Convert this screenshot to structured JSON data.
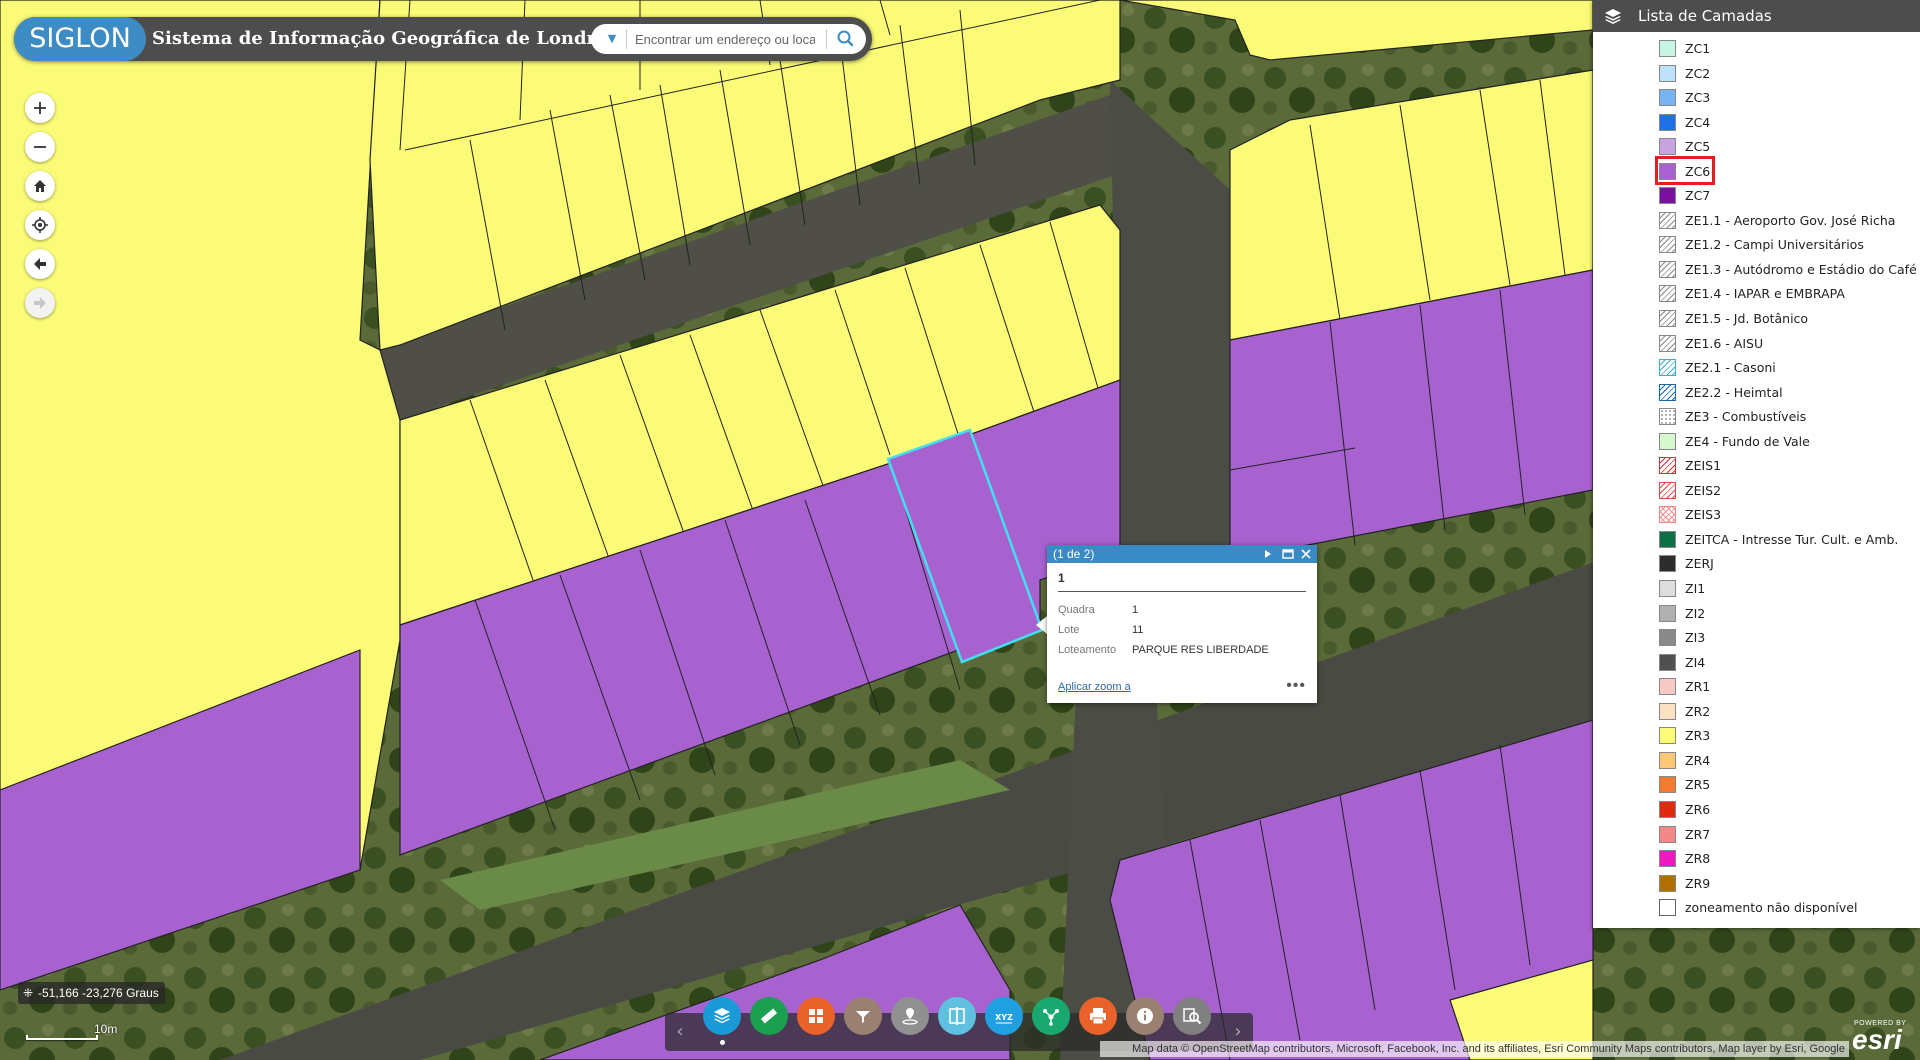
{
  "header": {
    "logo_text": "SIGLON",
    "title": "Sistema de Informação Geográfica de Londrina",
    "search_placeholder": "Encontrar um endereço ou local"
  },
  "popup": {
    "counter": "(1 de 2)",
    "title": "1",
    "fields": [
      {
        "key": "Quadra",
        "value": "1"
      },
      {
        "key": "Lote",
        "value": "11"
      },
      {
        "key": "Loteamento",
        "value": "PARQUE RES LIBERDADE"
      }
    ],
    "zoom_link": "Aplicar zoom a",
    "more": "•••"
  },
  "layer_panel": {
    "title": "Lista de Camadas",
    "highlighted": "ZC6",
    "items": [
      {
        "label": "ZC1",
        "color": "#c6f5e4",
        "pattern": "solid"
      },
      {
        "label": "ZC2",
        "color": "#bfe2fb",
        "pattern": "solid"
      },
      {
        "label": "ZC3",
        "color": "#78b4f2",
        "pattern": "solid"
      },
      {
        "label": "ZC4",
        "color": "#1e6fe8",
        "pattern": "solid"
      },
      {
        "label": "ZC5",
        "color": "#c7a4e0",
        "pattern": "solid"
      },
      {
        "label": "ZC6",
        "color": "#a862d0",
        "pattern": "solid"
      },
      {
        "label": "ZC7",
        "color": "#7a10a0",
        "pattern": "solid"
      },
      {
        "label": "ZE1.1 - Aeroporto Gov. José Richa",
        "color": "#888888",
        "pattern": "hatch"
      },
      {
        "label": "ZE1.2 - Campi Universitários",
        "color": "#888888",
        "pattern": "hatch"
      },
      {
        "label": "ZE1.3 - Autódromo e Estádio do Café",
        "color": "#888888",
        "pattern": "hatch"
      },
      {
        "label": "ZE1.4 - IAPAR e EMBRAPA",
        "color": "#888888",
        "pattern": "hatch"
      },
      {
        "label": "ZE1.5 - Jd. Botânico",
        "color": "#888888",
        "pattern": "hatch"
      },
      {
        "label": "ZE1.6 - AISU",
        "color": "#888888",
        "pattern": "hatch"
      },
      {
        "label": "ZE2.1 - Casoni",
        "color": "#3aaad8",
        "pattern": "hatch"
      },
      {
        "label": "ZE2.2 - Heimtal",
        "color": "#1a6aa8",
        "pattern": "hatch"
      },
      {
        "label": "ZE3 - Combustíveis",
        "color": "#999999",
        "pattern": "dots"
      },
      {
        "label": "ZE4 - Fundo de Vale",
        "color": "#d6f8cc",
        "pattern": "solid"
      },
      {
        "label": "ZEIS1",
        "color": "#d83030",
        "pattern": "hatch"
      },
      {
        "label": "ZEIS2",
        "color": "#e04848",
        "pattern": "hatch"
      },
      {
        "label": "ZEIS3",
        "color": "#f08888",
        "pattern": "cross"
      },
      {
        "label": "ZEITCA - Intresse Tur. Cult. e Amb.",
        "color": "#0e6e48",
        "pattern": "solid"
      },
      {
        "label": "ZERJ",
        "color": "#2c2c2c",
        "pattern": "solid"
      },
      {
        "label": "ZI1",
        "color": "#dddddd",
        "pattern": "solid"
      },
      {
        "label": "ZI2",
        "color": "#b0b0b0",
        "pattern": "solid"
      },
      {
        "label": "ZI3",
        "color": "#8a8a8a",
        "pattern": "solid"
      },
      {
        "label": "ZI4",
        "color": "#505050",
        "pattern": "solid"
      },
      {
        "label": "ZR1",
        "color": "#f8c8c4",
        "pattern": "solid"
      },
      {
        "label": "ZR2",
        "color": "#fbe0c2",
        "pattern": "solid"
      },
      {
        "label": "ZR3",
        "color": "#fbfb78",
        "pattern": "solid"
      },
      {
        "label": "ZR4",
        "color": "#fcc878",
        "pattern": "solid"
      },
      {
        "label": "ZR5",
        "color": "#f47a30",
        "pattern": "solid"
      },
      {
        "label": "ZR6",
        "color": "#e02a10",
        "pattern": "solid"
      },
      {
        "label": "ZR7",
        "color": "#f48888",
        "pattern": "solid"
      },
      {
        "label": "ZR8",
        "color": "#f018c0",
        "pattern": "solid"
      },
      {
        "label": "ZR9",
        "color": "#b07000",
        "pattern": "solid"
      },
      {
        "label": "zoneamento não disponível",
        "color": "#ffffff",
        "pattern": "solid"
      }
    ]
  },
  "coordinates": "-51,166 -23,276 Graus",
  "scale_label": "10m",
  "toolbar": {
    "tools": [
      {
        "name": "layers-tool",
        "icon": "layers-icon",
        "color": "#1a9ad6"
      },
      {
        "name": "measure-tool",
        "icon": "ruler-icon",
        "color": "#1aa050"
      },
      {
        "name": "basemap-tool",
        "icon": "grid-icon",
        "color": "#e8622a"
      },
      {
        "name": "filter-tool",
        "icon": "filter-icon",
        "color": "#9a8070"
      },
      {
        "name": "locate-tool",
        "icon": "map-pin-icon",
        "color": "#909090"
      },
      {
        "name": "swipe-tool",
        "icon": "swipe-icon",
        "color": "#60c0e0"
      },
      {
        "name": "xyz-tool",
        "icon": "xyz-icon",
        "color": "#20a0e0",
        "label": "XYZ"
      },
      {
        "name": "share-tool",
        "icon": "share-icon",
        "color": "#18a870"
      },
      {
        "name": "print-tool",
        "icon": "printer-icon",
        "color": "#e8622a"
      },
      {
        "name": "info-tool",
        "icon": "info-icon",
        "color": "#9a8070"
      },
      {
        "name": "query-tool",
        "icon": "search-map-icon",
        "color": "#808080"
      }
    ]
  },
  "attribution": "Map data © OpenStreetMap contributors, Microsoft, Facebook, Inc. and its affiliates, Esri Community Maps contributors, Map layer by Esri, Google",
  "esri": {
    "powered": "POWERED BY",
    "brand": "esri"
  },
  "colors": {
    "zr3_yellow": "#fbfb78",
    "zc6_purple": "#a862d0",
    "selection": "#40e0f0",
    "header_bg": "#4d4d4d",
    "accent": "#3a8ac6"
  }
}
